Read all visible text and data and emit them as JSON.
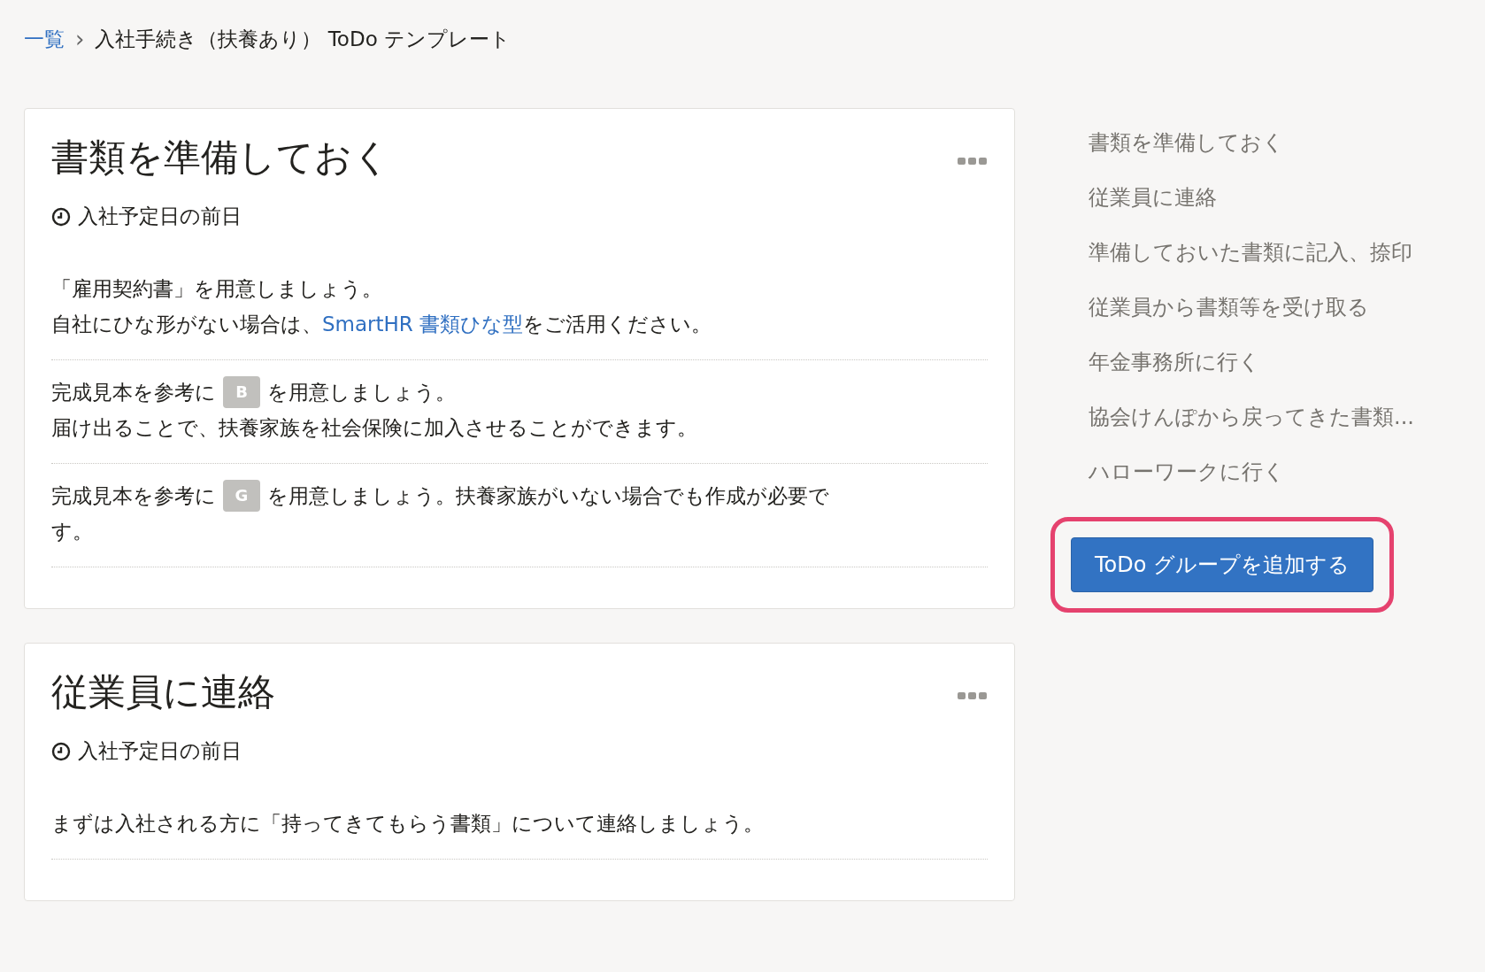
{
  "breadcrumb": {
    "link": "一覧",
    "separator": "›",
    "current": "入社手続き（扶養あり） ToDo テンプレート"
  },
  "groups": [
    {
      "title": "書類を準備しておく",
      "timing": "入社予定日の前日",
      "items": [
        {
          "lines": [
            [
              {
                "kind": "text",
                "text": "「雇用契約書」を用意しましょう。"
              }
            ],
            [
              {
                "kind": "text",
                "text": "自社にひな形がない場合は、 "
              },
              {
                "kind": "link",
                "text": "SmartHR 書類ひな型"
              },
              {
                "kind": "text",
                "text": "をご活用ください。"
              }
            ]
          ]
        },
        {
          "lines": [
            [
              {
                "kind": "text",
                "text": "完成見本を参考に"
              },
              {
                "kind": "badge",
                "text": "B"
              },
              {
                "kind": "text",
                "text": "を用意しましょう。"
              }
            ],
            [
              {
                "kind": "text",
                "text": "届け出ることで、扶養家族を社会保険に加入させることができます。"
              }
            ]
          ]
        },
        {
          "lines": [
            [
              {
                "kind": "text",
                "text": "完成見本を参考に"
              },
              {
                "kind": "badge",
                "text": "G"
              },
              {
                "kind": "text",
                "text": "を用意しましょう。扶養家族がいない場合でも作成が必要で"
              }
            ],
            [
              {
                "kind": "text",
                "text": "す。"
              }
            ]
          ]
        }
      ]
    },
    {
      "title": "従業員に連絡",
      "timing": "入社予定日の前日",
      "items": [
        {
          "lines": [
            [
              {
                "kind": "text",
                "text": "まずは入社される方に「持ってきてもらう書類」について連絡しましょう。"
              }
            ]
          ]
        }
      ]
    }
  ],
  "nav": [
    "書類を準備しておく",
    "従業員に連絡",
    "準備しておいた書類に記入、捺印",
    "従業員から書類等を受け取る",
    "年金事務所に行く",
    "協会けんぽから戻ってきた書類...",
    "ハローワークに行く"
  ],
  "add_button": {
    "label": "ToDo グループを追加する",
    "highlighted": true
  }
}
